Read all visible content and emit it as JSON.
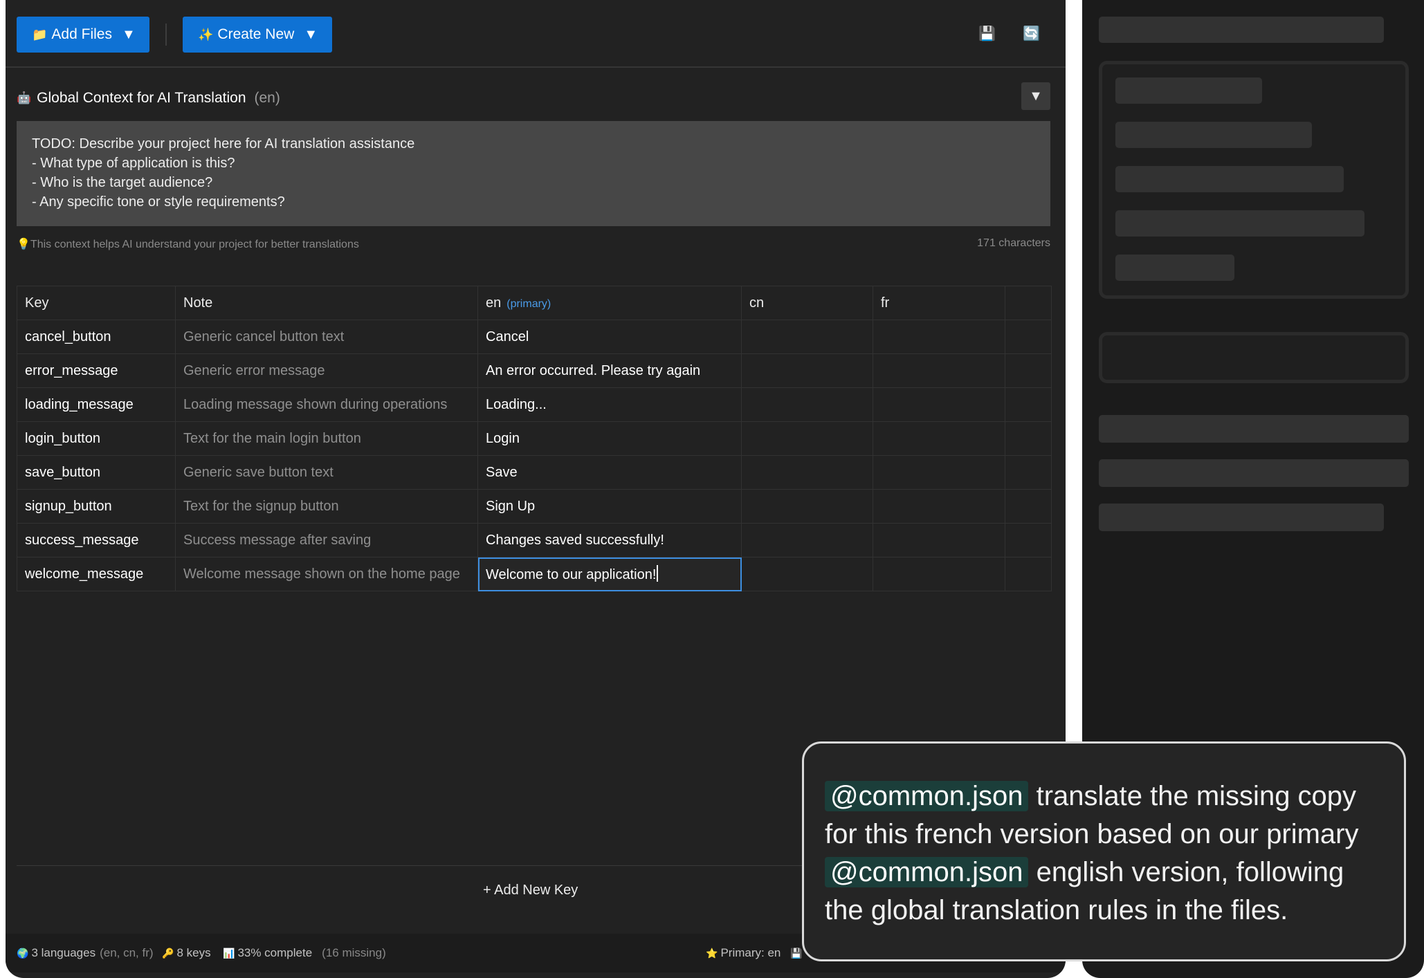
{
  "toolbar": {
    "add_files": {
      "icon": "folder-icon",
      "label": "Add Files"
    },
    "create_new": {
      "icon": "sparkles-icon",
      "label": "Create New"
    },
    "save_icon": "floppy-disk-icon",
    "refresh_icon": "refresh-icon"
  },
  "context": {
    "title": "Global Context for AI Translation",
    "lang": "(en)",
    "text": "TODO: Describe your project here for AI translation assistance\n- What type of application is this?\n- Who is the target audience?\n- Any specific tone or style requirements?",
    "hint": "This context helps AI understand your project for better translations",
    "char_count": "171 characters"
  },
  "table": {
    "headers": {
      "key": "Key",
      "note": "Note",
      "en": "en",
      "en_tag": "(primary)",
      "cn": "cn",
      "fr": "fr"
    },
    "rows": [
      {
        "key": "cancel_button",
        "note": "Generic cancel button text",
        "en": "Cancel",
        "cn": "",
        "fr": ""
      },
      {
        "key": "error_message",
        "note": "Generic error message",
        "en": "An error occurred. Please try again",
        "cn": "",
        "fr": ""
      },
      {
        "key": "loading_message",
        "note": "Loading message shown during operations",
        "en": "Loading...",
        "cn": "",
        "fr": ""
      },
      {
        "key": "login_button",
        "note": "Text for the main login button",
        "en": "Login",
        "cn": "",
        "fr": ""
      },
      {
        "key": "save_button",
        "note": "Generic save button text",
        "en": "Save",
        "cn": "",
        "fr": ""
      },
      {
        "key": "signup_button",
        "note": "Text for the signup button",
        "en": "Sign Up",
        "cn": "",
        "fr": ""
      },
      {
        "key": "success_message",
        "note": "Success message after saving",
        "en": "Changes saved successfully!",
        "cn": "",
        "fr": ""
      },
      {
        "key": "welcome_message",
        "note": "Welcome message shown on the home page",
        "en": "Welcome to our application!",
        "cn": "",
        "fr": ""
      }
    ]
  },
  "add_key_label": "+ Add New Key",
  "status": {
    "languages": "3 languages",
    "languages_list": "(en, cn, fr)",
    "keys": "8 keys",
    "complete": "33% complete",
    "missing": "(16 missing)",
    "primary": "Primary: en"
  },
  "prompt": {
    "mention": "@common.json",
    "part1": " translate the missing copy for this french version based on our primary ",
    "part2": " english version, following the global translation rules in the files."
  }
}
